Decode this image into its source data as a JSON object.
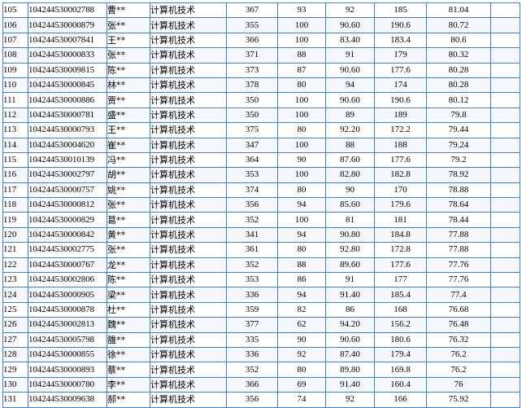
{
  "table": {
    "rows": [
      [
        "105",
        "104244530002788",
        "曹**",
        "计算机技术",
        "367",
        "93",
        "92",
        "185",
        "81.04"
      ],
      [
        "106",
        "104244530000879",
        "张**",
        "计算机技术",
        "355",
        "100",
        "90.60",
        "190.6",
        "80.72"
      ],
      [
        "107",
        "104244530007841",
        "王**",
        "计算机技术",
        "366",
        "100",
        "83.40",
        "183.4",
        "80.6"
      ],
      [
        "108",
        "104244530000833",
        "张**",
        "计算机技术",
        "371",
        "88",
        "91",
        "179",
        "80.32"
      ],
      [
        "109",
        "104244530009815",
        "陈**",
        "计算机技术",
        "373",
        "87",
        "90.60",
        "177.6",
        "80.28"
      ],
      [
        "110",
        "104244530000845",
        "林**",
        "计算机技术",
        "378",
        "80",
        "94",
        "174",
        "80.28"
      ],
      [
        "111",
        "104244530000886",
        "贾**",
        "计算机技术",
        "350",
        "100",
        "90.60",
        "190.6",
        "80.12"
      ],
      [
        "112",
        "104244530000781",
        "盛**",
        "计算机技术",
        "350",
        "100",
        "89",
        "189",
        "79.8"
      ],
      [
        "113",
        "104244530000793",
        "王**",
        "计算机技术",
        "375",
        "80",
        "92.20",
        "172.2",
        "79.44"
      ],
      [
        "114",
        "104244530004620",
        "崔**",
        "计算机技术",
        "347",
        "100",
        "88",
        "188",
        "79.24"
      ],
      [
        "115",
        "104244530010139",
        "冯**",
        "计算机技术",
        "364",
        "90",
        "87.60",
        "177.6",
        "79.2"
      ],
      [
        "116",
        "104244530002797",
        "胡**",
        "计算机技术",
        "353",
        "100",
        "82.80",
        "182.8",
        "78.92"
      ],
      [
        "117",
        "104244530000757",
        "姚**",
        "计算机技术",
        "374",
        "80",
        "90",
        "170",
        "78.88"
      ],
      [
        "118",
        "104244530000812",
        "张**",
        "计算机技术",
        "356",
        "94",
        "85.60",
        "179.6",
        "78.64"
      ],
      [
        "119",
        "104244530000829",
        "葛**",
        "计算机技术",
        "352",
        "100",
        "81",
        "181",
        "78.44"
      ],
      [
        "120",
        "104244530000842",
        "黄**",
        "计算机技术",
        "341",
        "94",
        "90.80",
        "184.8",
        "77.88"
      ],
      [
        "121",
        "104244530002775",
        "张**",
        "计算机技术",
        "361",
        "80",
        "92.80",
        "172.8",
        "77.88"
      ],
      [
        "122",
        "104244530000767",
        "龙**",
        "计算机技术",
        "352",
        "88",
        "89.60",
        "177.6",
        "77.76"
      ],
      [
        "123",
        "104244530002806",
        "陈**",
        "计算机技术",
        "353",
        "86",
        "91",
        "177",
        "77.76"
      ],
      [
        "124",
        "104244530000905",
        "梁**",
        "计算机技术",
        "336",
        "94",
        "91.40",
        "185.4",
        "77.4"
      ],
      [
        "125",
        "104244530000878",
        "杜**",
        "计算机技术",
        "359",
        "82",
        "86",
        "168",
        "76.68"
      ],
      [
        "126",
        "104244530002813",
        "魏**",
        "计算机技术",
        "377",
        "62",
        "94.20",
        "156.2",
        "76.48"
      ],
      [
        "127",
        "104244530005798",
        "雒**",
        "计算机技术",
        "335",
        "90",
        "90.60",
        "180.6",
        "76.32"
      ],
      [
        "128",
        "104244530000855",
        "徐**",
        "计算机技术",
        "336",
        "92",
        "87.40",
        "179.4",
        "76.2"
      ],
      [
        "129",
        "104244530000893",
        "蔡**",
        "计算机技术",
        "352",
        "80",
        "89.80",
        "169.8",
        "76.2"
      ],
      [
        "130",
        "104244530000780",
        "李**",
        "计算机技术",
        "366",
        "69",
        "91.40",
        "160.4",
        "76"
      ],
      [
        "131",
        "104244530009638",
        "郝**",
        "计算机技术",
        "356",
        "74",
        "92",
        "166",
        "75.92"
      ]
    ]
  }
}
